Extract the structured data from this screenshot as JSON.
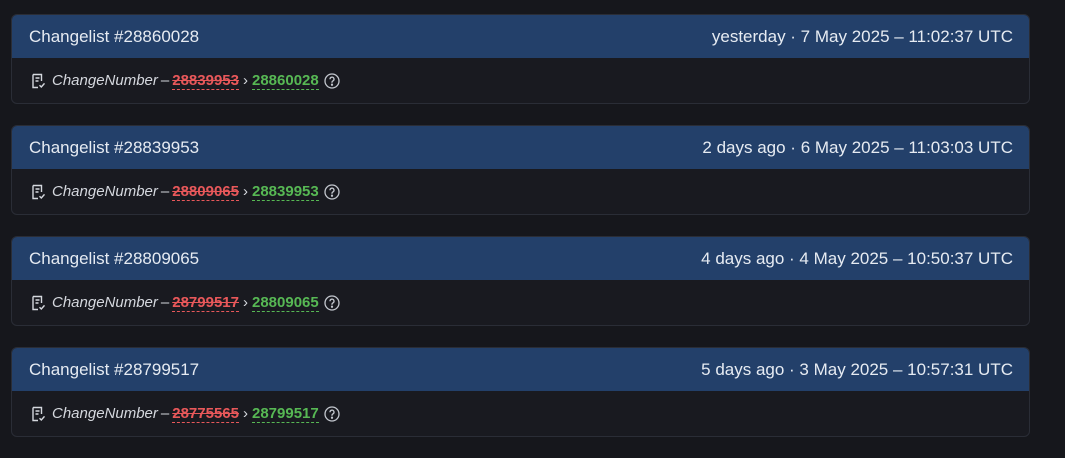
{
  "changelists": [
    {
      "title": "Changelist #28860028",
      "date": "yesterday · 7 May 2025 – 11:02:37 UTC",
      "field": "ChangeNumber",
      "dash": "–",
      "old_value": "28839953",
      "separator": "›",
      "new_value": "28860028"
    },
    {
      "title": "Changelist #28839953",
      "date": "2 days ago · 6 May 2025 – 11:03:03 UTC",
      "field": "ChangeNumber",
      "dash": "–",
      "old_value": "28809065",
      "separator": "›",
      "new_value": "28839953"
    },
    {
      "title": "Changelist #28809065",
      "date": "4 days ago · 4 May 2025 – 10:50:37 UTC",
      "field": "ChangeNumber",
      "dash": "–",
      "old_value": "28799517",
      "separator": "›",
      "new_value": "28809065"
    },
    {
      "title": "Changelist #28799517",
      "date": "5 days ago · 3 May 2025 – 10:57:31 UTC",
      "field": "ChangeNumber",
      "dash": "–",
      "old_value": "28775565",
      "separator": "›",
      "new_value": "28799517"
    }
  ],
  "icons": {
    "field_icon": "document-edit-icon",
    "help_icon": "question-circle-icon"
  },
  "colors": {
    "header_bg": "#23406a",
    "removed": "#e8585a",
    "added": "#57b854"
  }
}
